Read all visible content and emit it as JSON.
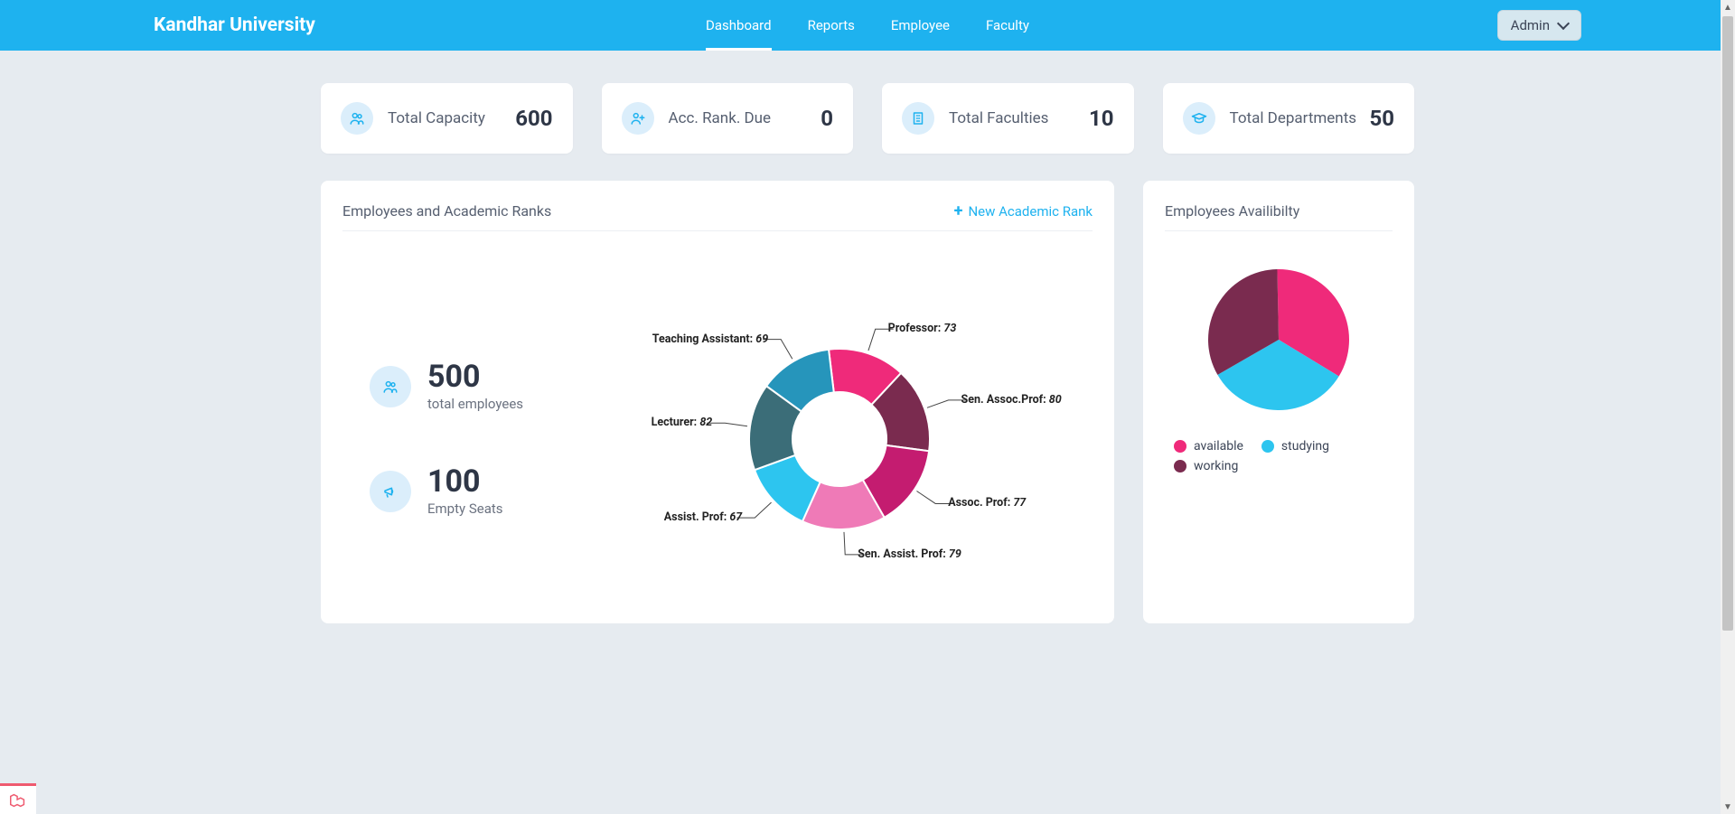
{
  "header": {
    "brand": "Kandhar University",
    "nav": [
      "Dashboard",
      "Reports",
      "Employee",
      "Faculty"
    ],
    "active_nav": 0,
    "admin_label": "Admin"
  },
  "stats": [
    {
      "label": "Total Capacity",
      "value": "600",
      "icon": "users"
    },
    {
      "label": "Acc. Rank. Due",
      "value": "0",
      "icon": "users-plus"
    },
    {
      "label": "Total Faculties",
      "value": "10",
      "icon": "building"
    },
    {
      "label": "Total Departments",
      "value": "50",
      "icon": "grad-cap"
    }
  ],
  "panel_ranks": {
    "title": "Employees and Academic Ranks",
    "new_link": "New Academic Rank",
    "left": [
      {
        "value": "500",
        "label": "total employees",
        "icon": "users"
      },
      {
        "value": "100",
        "label": "Empty Seats",
        "icon": "megaphone"
      }
    ]
  },
  "panel_avail": {
    "title": "Employees Availibilty"
  },
  "chart_data": [
    {
      "type": "pie",
      "name": "academic_ranks_donut",
      "donut": true,
      "series": [
        {
          "name": "Professor",
          "value": 73,
          "color": "#ef2a7a"
        },
        {
          "name": "Sen. Assoc.Prof",
          "value": 80,
          "color": "#7a2b4f"
        },
        {
          "name": "Assoc. Prof",
          "value": 77,
          "color": "#c41c70"
        },
        {
          "name": "Sen. Assist. Prof",
          "value": 79,
          "color": "#ef7ab7"
        },
        {
          "name": "Assist. Prof",
          "value": 67,
          "color": "#2dc5ef"
        },
        {
          "name": "Lecturer",
          "value": 82,
          "color": "#3b6d78"
        },
        {
          "name": "Teaching Assistant",
          "value": 69,
          "color": "#2695bb"
        }
      ]
    },
    {
      "type": "pie",
      "name": "employees_availability_pie",
      "donut": false,
      "series": [
        {
          "name": "available",
          "value": 34,
          "color": "#ef2a7a"
        },
        {
          "name": "studying",
          "value": 33,
          "color": "#2dc5ef"
        },
        {
          "name": "working",
          "value": 33,
          "color": "#7a2b4f"
        }
      ]
    }
  ]
}
